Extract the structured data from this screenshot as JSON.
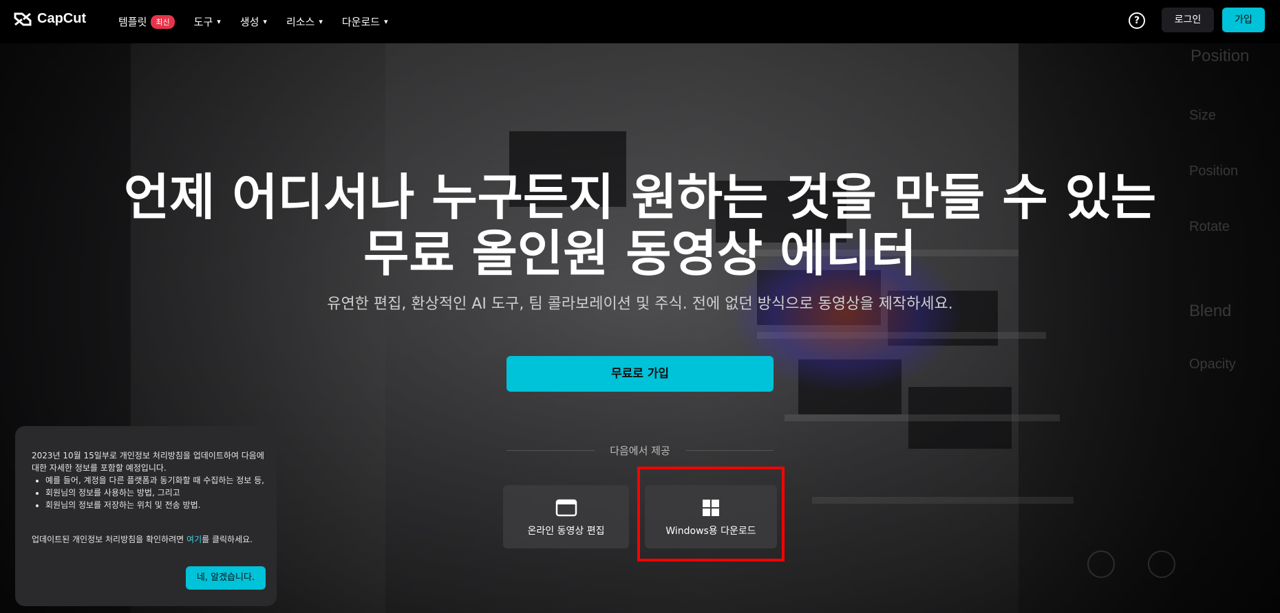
{
  "nav": {
    "logo_text": "CapCut",
    "items": [
      {
        "label": "템플릿",
        "badge": "최신"
      },
      {
        "label": "도구"
      },
      {
        "label": "생성"
      },
      {
        "label": "리소스"
      },
      {
        "label": "다운로드"
      }
    ],
    "help_icon": "?",
    "login_label": "로그인",
    "signup_label": "가입"
  },
  "hero": {
    "title_line1": "언제 어디서나 누구든지 원하는 것을 만들 수 있는",
    "title_line2": "무료 올인원 동영상 에디터",
    "subtitle": "유연한 편집, 환상적인 AI 도구, 팀 콜라보레이션 및 주식. 전에 없던 방식으로 동영상을 제작하세요.",
    "cta_label": "무료로 가입",
    "provided_label": "다음에서 제공",
    "online_edit_label": "온라인 동영상 편집",
    "windows_download_label": "Windows용 다운로드"
  },
  "background_text": {
    "position": "Position",
    "size": "Size",
    "position2": "Position",
    "rotate": "Rotate",
    "blend": "Blend",
    "opacity": "Opacity"
  },
  "privacy_popup": {
    "intro": "2023년 10월 15일부로 개인정보 처리방침을 업데이트하여 다음에 대한 자세한 정보를 포함할 예정입니다.",
    "bullets": [
      "예를 들어, 계정을 다른 플랫폼과 동기화할 때 수집하는 정보 등,",
      "회원님의 정보를 사용하는 방법, 그리고",
      "회원님의 정보를 저장하는 위치 및 전송 방법."
    ],
    "outro_before": "업데이트된 개인정보 처리방침을 확인하려면 ",
    "outro_link": "여기",
    "outro_after": "를 클릭하세요.",
    "ok_label": "네, 알겠습니다."
  },
  "colors": {
    "accent": "#00c2d8",
    "badge": "#e8344a",
    "highlight": "#ff0000",
    "nav_bg": "#000000"
  },
  "icons": [
    "capcut-logo-icon",
    "chevron-down-icon",
    "help-icon",
    "browser-window-icon",
    "windows-logo-icon"
  ]
}
